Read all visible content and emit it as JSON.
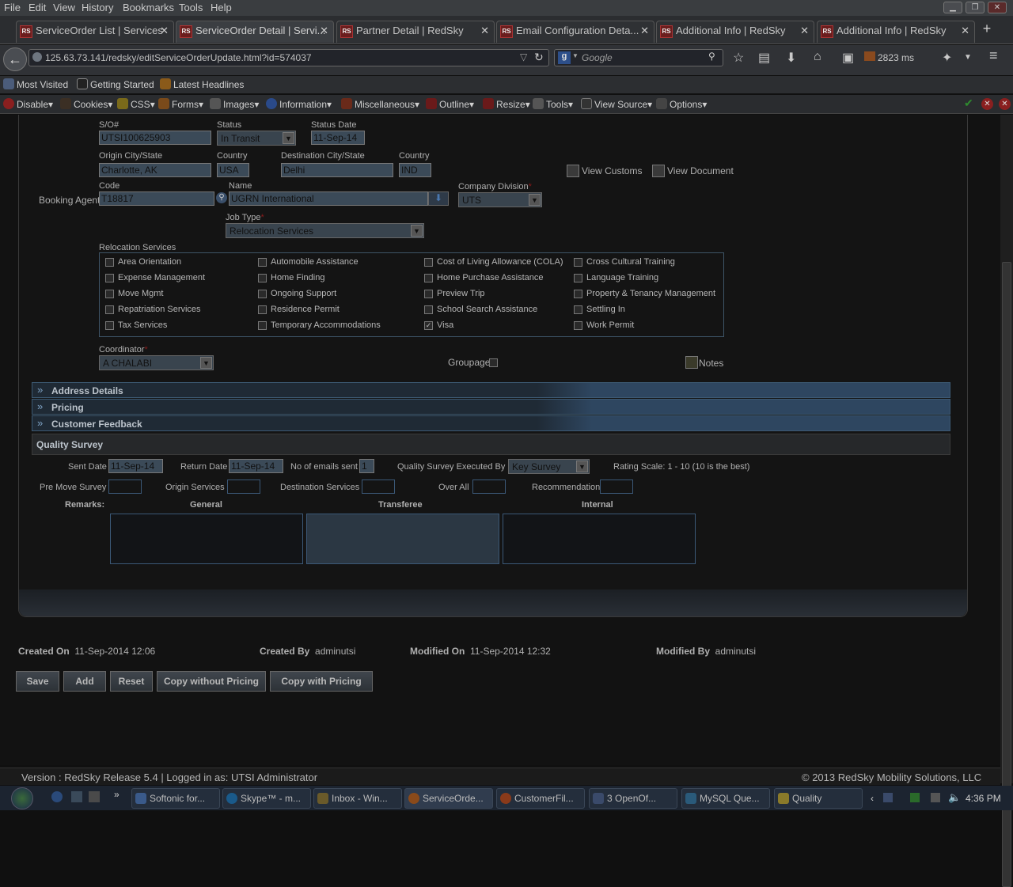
{
  "menu": [
    "File",
    "Edit",
    "View",
    "History",
    "Bookmarks",
    "Tools",
    "Help"
  ],
  "tabs": [
    {
      "label": "ServiceOrder List | Services"
    },
    {
      "label": "ServiceOrder Detail | Servi..."
    },
    {
      "label": "Partner Detail | RedSky"
    },
    {
      "label": "Email Configuration Deta..."
    },
    {
      "label": "Additional Info | RedSky"
    },
    {
      "label": "Additional Info | RedSky"
    }
  ],
  "address_bar": {
    "url": "125.63.73.141/redsky/editServiceOrderUpdate.html?id=574037"
  },
  "search": {
    "placeholder": "Google"
  },
  "nav": {
    "load_time": "2823 ms"
  },
  "bookmarks": [
    "Most Visited",
    "Getting Started",
    "Latest Headlines"
  ],
  "webdev": [
    "Disable",
    "Cookies",
    "CSS",
    "Forms",
    "Images",
    "Information",
    "Miscellaneous",
    "Outline",
    "Resize",
    "Tools",
    "View Source",
    "Options"
  ],
  "form": {
    "so_label": "S/O#",
    "so_value": "UTSI100625903",
    "status_label": "Status",
    "status_value": "In Transit",
    "status_date_label": "Status Date",
    "status_date_value": "11-Sep-14",
    "origin_label": "Origin City/State",
    "origin_value": "Charlotte, AK",
    "origin_country_label": "Country",
    "origin_country_value": "USA",
    "dest_label": "Destination City/State",
    "dest_value": "Delhi",
    "dest_country_label": "Country",
    "dest_country_value": "IND",
    "view_customs": "View Customs",
    "view_document": "View Document",
    "code_label": "Code",
    "booking_agent_label": "Booking Agent:",
    "code_value": "T18817",
    "name_label": "Name",
    "name_value": "UGRN International",
    "company_division_label": "Company Division",
    "company_division_value": "UTS",
    "job_type_label": "Job Type",
    "job_type_value": "Relocation Services",
    "relocation_label": "Relocation Services",
    "coordinator_label": "Coordinator",
    "coordinator_value": "A CHALABI",
    "groupage_label": "Groupage",
    "notes_label": "Notes",
    "required_mark": "*"
  },
  "services": [
    {
      "label": "Area Orientation",
      "checked": false
    },
    {
      "label": "Automobile Assistance",
      "checked": false
    },
    {
      "label": "Cost of Living Allowance (COLA)",
      "checked": false
    },
    {
      "label": "Cross Cultural Training",
      "checked": false
    },
    {
      "label": "Expense Management",
      "checked": false
    },
    {
      "label": "Home Finding",
      "checked": false
    },
    {
      "label": "Home Purchase Assistance",
      "checked": false
    },
    {
      "label": "Language Training",
      "checked": false
    },
    {
      "label": "Move Mgmt",
      "checked": false
    },
    {
      "label": "Ongoing Support",
      "checked": false
    },
    {
      "label": "Preview Trip",
      "checked": false
    },
    {
      "label": "Property & Tenancy Management",
      "checked": false
    },
    {
      "label": "Repatriation Services",
      "checked": false
    },
    {
      "label": "Residence Permit",
      "checked": false
    },
    {
      "label": "School Search Assistance",
      "checked": false
    },
    {
      "label": "Settling In",
      "checked": false
    },
    {
      "label": "Tax Services",
      "checked": false
    },
    {
      "label": "Temporary Accommodations",
      "checked": false
    },
    {
      "label": "Visa",
      "checked": true
    },
    {
      "label": "Work Permit",
      "checked": false
    }
  ],
  "sections": {
    "address": "Address Details",
    "pricing": "Pricing",
    "feedback": "Customer Feedback",
    "quality": "Quality Survey"
  },
  "quality": {
    "sent_date_label": "Sent Date",
    "sent_date_value": "11-Sep-14",
    "return_date_label": "Return Date",
    "return_date_value": "11-Sep-14",
    "emails_label": "No of emails sent",
    "emails_value": "1",
    "executed_label": "Quality Survey Executed By",
    "executed_value": "Key Survey",
    "rating_scale": "Rating Scale:  1 - 10 (10 is the best)",
    "pre_move_label": "Pre Move Survey",
    "origin_services_label": "Origin Services",
    "dest_services_label": "Destination Services",
    "over_all_label": "Over All",
    "recommendation_label": "Recommendation",
    "remarks_label": "Remarks:",
    "general_label": "General",
    "transferee_label": "Transferee",
    "internal_label": "Internal"
  },
  "audit": {
    "created_on_label": "Created On",
    "created_on_value": "11-Sep-2014 12:06",
    "created_by_label": "Created By",
    "created_by_value": "adminutsi",
    "modified_on_label": "Modified On",
    "modified_on_value": "11-Sep-2014 12:32",
    "modified_by_label": "Modified By",
    "modified_by_value": "adminutsi"
  },
  "buttons": {
    "save": "Save",
    "add": "Add",
    "reset": "Reset",
    "copy_without": "Copy without Pricing",
    "copy_with": "Copy with Pricing"
  },
  "footer": {
    "version": "Version : RedSky Release 5.4 | Logged in as: UTSI Administrator",
    "copyright": "© 2013 RedSky Mobility Solutions, LLC"
  },
  "taskbar": {
    "items": [
      "Softonic for...",
      "Skype™ - m...",
      "Inbox - Win...",
      "ServiceOrde...",
      "CustomerFil...",
      "3 OpenOf...",
      "MySQL Que...",
      "Quality"
    ],
    "clock": "4:36 PM"
  }
}
